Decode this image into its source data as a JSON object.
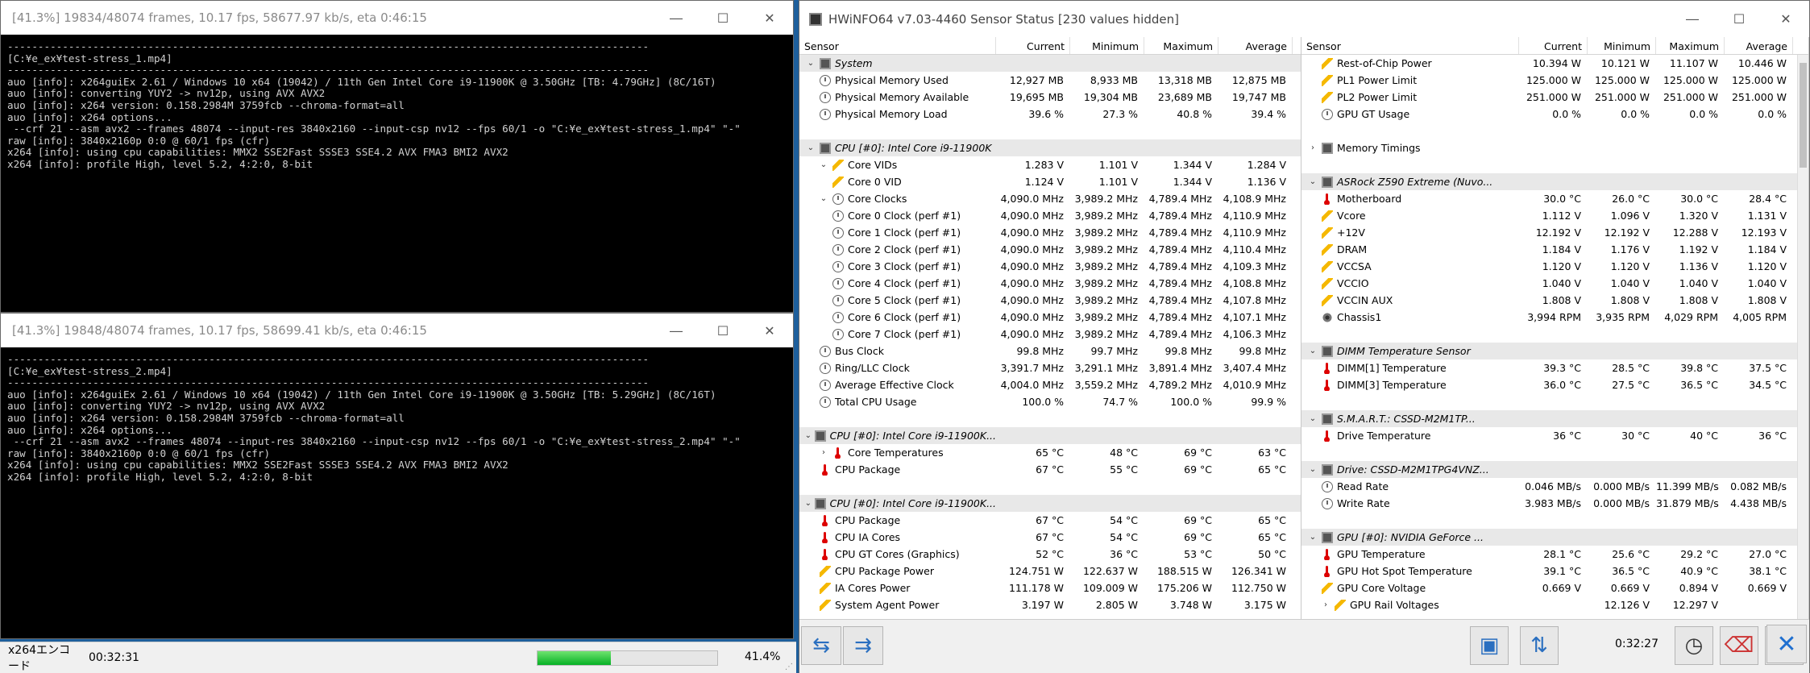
{
  "term1": {
    "title": "[41.3%] 19834/48074 frames, 10.17 fps, 58677.97 kb/s, eta 0:46:15",
    "lines": [
      "---------------------------------------------------------------------------------------------------------",
      "[C:¥e_ex¥test-stress_1.mp4]",
      "---------------------------------------------------------------------------------------------------------",
      "auo [info]: x264guiEx 2.61 / Windows 10 x64 (19042) / 11th Gen Intel Core i9-11900K @ 3.50GHz [TB: 4.79GHz] (8C/16T)",
      "auo [info]: converting YUY2 -> nv12p, using AVX AVX2",
      "auo [info]: x264 version: 0.158.2984M 3759fcb --chroma-format=all",
      "auo [info]: x264 options...",
      " --crf 21 --asm avx2 --frames 48074 --input-res 3840x2160 --input-csp nv12 --fps 60/1 -o \"C:¥e_ex¥test-stress_1.mp4\" \"-\"",
      "raw [info]: 3840x2160p 0:0 @ 60/1 fps (cfr)",
      "x264 [info]: using cpu capabilities: MMX2 SSE2Fast SSSE3 SSE4.2 AVX FMA3 BMI2 AVX2",
      "x264 [info]: profile High, level 5.2, 4:2:0, 8-bit"
    ]
  },
  "term2": {
    "title": "[41.3%] 19848/48074 frames, 10.17 fps, 58699.41 kb/s, eta 0:46:15",
    "lines": [
      "---------------------------------------------------------------------------------------------------------",
      "[C:¥e_ex¥test-stress_2.mp4]",
      "---------------------------------------------------------------------------------------------------------",
      "auo [info]: x264guiEx 2.61 / Windows 10 x64 (19042) / 11th Gen Intel Core i9-11900K @ 3.50GHz [TB: 5.29GHz] (8C/16T)",
      "auo [info]: converting YUY2 -> nv12p, using AVX AVX2",
      "auo [info]: x264 version: 0.158.2984M 3759fcb --chroma-format=all",
      "auo [info]: x264 options...",
      " --crf 21 --asm avx2 --frames 48074 --input-res 3840x2160 --input-csp nv12 --fps 60/1 -o \"C:¥e_ex¥test-stress_2.mp4\" \"-\"",
      "raw [info]: 3840x2160p 0:0 @ 60/1 fps (cfr)",
      "x264 [info]: using cpu capabilities: MMX2 SSE2Fast SSSE3 SSE4.2 AVX FMA3 BMI2 AVX2",
      "x264 [info]: profile High, level 5.2, 4:2:0, 8-bit"
    ]
  },
  "x264bar": {
    "label": "x264エンコード",
    "elapsed": "00:32:31",
    "percent": "41.4%",
    "progress": 0.41
  },
  "hwinfo": {
    "title": "HWiNFO64 v7.03-4460 Sensor Status [230 values hidden]",
    "headers": [
      "Sensor",
      "Current",
      "Minimum",
      "Maximum",
      "Average"
    ],
    "time": "0:32:27",
    "left_rows": [
      {
        "t": "group",
        "exp": "⌄",
        "icon": "chip",
        "name": "System"
      },
      {
        "t": "row",
        "icon": "clock",
        "name": "Physical Memory Used",
        "v": [
          "12,927 MB",
          "8,933 MB",
          "13,318 MB",
          "12,875 MB"
        ]
      },
      {
        "t": "row",
        "icon": "clock",
        "name": "Physical Memory Available",
        "v": [
          "19,695 MB",
          "19,304 MB",
          "23,689 MB",
          "19,747 MB"
        ]
      },
      {
        "t": "row",
        "icon": "clock",
        "name": "Physical Memory Load",
        "v": [
          "39.6 %",
          "27.3 %",
          "40.8 %",
          "39.4 %"
        ]
      },
      {
        "t": "blank"
      },
      {
        "t": "group",
        "exp": "⌄",
        "icon": "chip",
        "name": "CPU [#0]: Intel Core i9-11900K"
      },
      {
        "t": "row",
        "exp": "⌄",
        "icon": "volt",
        "name": "Core VIDs",
        "v": [
          "1.283 V",
          "1.101 V",
          "1.344 V",
          "1.284 V"
        ],
        "ind": 1
      },
      {
        "t": "row",
        "icon": "volt",
        "name": "Core 0 VID",
        "v": [
          "1.124 V",
          "1.101 V",
          "1.344 V",
          "1.136 V"
        ],
        "ind": 1
      },
      {
        "t": "row",
        "exp": "⌄",
        "icon": "clock",
        "name": "Core Clocks",
        "v": [
          "4,090.0 MHz",
          "3,989.2 MHz",
          "4,789.4 MHz",
          "4,108.9 MHz"
        ],
        "ind": 1
      },
      {
        "t": "row",
        "icon": "clock",
        "name": "Core 0 Clock (perf #1)",
        "v": [
          "4,090.0 MHz",
          "3,989.2 MHz",
          "4,789.4 MHz",
          "4,110.9 MHz"
        ],
        "ind": 1
      },
      {
        "t": "row",
        "icon": "clock",
        "name": "Core 1 Clock (perf #1)",
        "v": [
          "4,090.0 MHz",
          "3,989.2 MHz",
          "4,789.4 MHz",
          "4,110.9 MHz"
        ],
        "ind": 1
      },
      {
        "t": "row",
        "icon": "clock",
        "name": "Core 2 Clock (perf #1)",
        "v": [
          "4,090.0 MHz",
          "3,989.2 MHz",
          "4,789.4 MHz",
          "4,110.4 MHz"
        ],
        "ind": 1
      },
      {
        "t": "row",
        "icon": "clock",
        "name": "Core 3 Clock (perf #1)",
        "v": [
          "4,090.0 MHz",
          "3,989.2 MHz",
          "4,789.4 MHz",
          "4,109.3 MHz"
        ],
        "ind": 1
      },
      {
        "t": "row",
        "icon": "clock",
        "name": "Core 4 Clock (perf #1)",
        "v": [
          "4,090.0 MHz",
          "3,989.2 MHz",
          "4,789.4 MHz",
          "4,108.8 MHz"
        ],
        "ind": 1
      },
      {
        "t": "row",
        "icon": "clock",
        "name": "Core 5 Clock (perf #1)",
        "v": [
          "4,090.0 MHz",
          "3,989.2 MHz",
          "4,789.4 MHz",
          "4,107.8 MHz"
        ],
        "ind": 1
      },
      {
        "t": "row",
        "icon": "clock",
        "name": "Core 6 Clock (perf #1)",
        "v": [
          "4,090.0 MHz",
          "3,989.2 MHz",
          "4,789.4 MHz",
          "4,107.1 MHz"
        ],
        "ind": 1
      },
      {
        "t": "row",
        "icon": "clock",
        "name": "Core 7 Clock (perf #1)",
        "v": [
          "4,090.0 MHz",
          "3,989.2 MHz",
          "4,789.4 MHz",
          "4,106.3 MHz"
        ],
        "ind": 1
      },
      {
        "t": "row",
        "icon": "clock",
        "name": "Bus Clock",
        "v": [
          "99.8 MHz",
          "99.7 MHz",
          "99.8 MHz",
          "99.8 MHz"
        ]
      },
      {
        "t": "row",
        "icon": "clock",
        "name": "Ring/LLC Clock",
        "v": [
          "3,391.7 MHz",
          "3,291.1 MHz",
          "3,891.4 MHz",
          "3,407.4 MHz"
        ]
      },
      {
        "t": "row",
        "icon": "clock",
        "name": "Average Effective Clock",
        "v": [
          "4,004.0 MHz",
          "3,559.2 MHz",
          "4,789.2 MHz",
          "4,010.9 MHz"
        ]
      },
      {
        "t": "row",
        "icon": "clock",
        "name": "Total CPU Usage",
        "v": [
          "100.0 %",
          "74.7 %",
          "100.0 %",
          "99.9 %"
        ]
      },
      {
        "t": "blank"
      },
      {
        "t": "group",
        "exp": "⌄",
        "icon": "chip",
        "name": "CPU [#0]: Intel Core i9-11900K..."
      },
      {
        "t": "row",
        "exp": "›",
        "icon": "therm",
        "name": "Core Temperatures",
        "v": [
          "65 °C",
          "48 °C",
          "69 °C",
          "63 °C"
        ],
        "ind": 1
      },
      {
        "t": "row",
        "icon": "therm",
        "name": "CPU Package",
        "v": [
          "67 °C",
          "55 °C",
          "69 °C",
          "65 °C"
        ]
      },
      {
        "t": "blank"
      },
      {
        "t": "group",
        "exp": "⌄",
        "icon": "chip",
        "name": "CPU [#0]: Intel Core i9-11900K..."
      },
      {
        "t": "row",
        "icon": "therm",
        "name": "CPU Package",
        "v": [
          "67 °C",
          "54 °C",
          "69 °C",
          "65 °C"
        ]
      },
      {
        "t": "row",
        "icon": "therm",
        "name": "CPU IA Cores",
        "v": [
          "67 °C",
          "54 °C",
          "69 °C",
          "65 °C"
        ]
      },
      {
        "t": "row",
        "icon": "therm",
        "name": "CPU GT Cores (Graphics)",
        "v": [
          "52 °C",
          "36 °C",
          "53 °C",
          "50 °C"
        ]
      },
      {
        "t": "row",
        "icon": "volt",
        "name": "CPU Package Power",
        "v": [
          "124.751 W",
          "122.637 W",
          "188.515 W",
          "126.341 W"
        ]
      },
      {
        "t": "row",
        "icon": "volt",
        "name": "IA Cores Power",
        "v": [
          "111.178 W",
          "109.009 W",
          "175.206 W",
          "112.750 W"
        ]
      },
      {
        "t": "row",
        "icon": "volt",
        "name": "System Agent Power",
        "v": [
          "3.197 W",
          "2.805 W",
          "3.748 W",
          "3.175 W"
        ]
      }
    ],
    "right_rows": [
      {
        "t": "row",
        "icon": "volt",
        "name": "Rest-of-Chip Power",
        "v": [
          "10.394 W",
          "10.121 W",
          "11.107 W",
          "10.446 W"
        ]
      },
      {
        "t": "row",
        "icon": "volt",
        "name": "PL1 Power Limit",
        "v": [
          "125.000 W",
          "125.000 W",
          "125.000 W",
          "125.000 W"
        ]
      },
      {
        "t": "row",
        "icon": "volt",
        "name": "PL2 Power Limit",
        "v": [
          "251.000 W",
          "251.000 W",
          "251.000 W",
          "251.000 W"
        ]
      },
      {
        "t": "row",
        "icon": "clock",
        "name": "GPU GT Usage",
        "v": [
          "0.0 %",
          "0.0 %",
          "0.0 %",
          "0.0 %"
        ]
      },
      {
        "t": "blank"
      },
      {
        "t": "group",
        "exp": "›",
        "icon": "chip",
        "name": "Memory Timings",
        "plain": true
      },
      {
        "t": "blank"
      },
      {
        "t": "group",
        "exp": "⌄",
        "icon": "chip",
        "name": "ASRock Z590 Extreme (Nuvo..."
      },
      {
        "t": "row",
        "icon": "therm",
        "name": "Motherboard",
        "v": [
          "30.0 °C",
          "26.0 °C",
          "30.0 °C",
          "28.4 °C"
        ]
      },
      {
        "t": "row",
        "icon": "volt",
        "name": "Vcore",
        "v": [
          "1.112 V",
          "1.096 V",
          "1.320 V",
          "1.131 V"
        ]
      },
      {
        "t": "row",
        "icon": "volt",
        "name": "+12V",
        "v": [
          "12.192 V",
          "12.192 V",
          "12.288 V",
          "12.193 V"
        ]
      },
      {
        "t": "row",
        "icon": "volt",
        "name": "DRAM",
        "v": [
          "1.184 V",
          "1.176 V",
          "1.192 V",
          "1.184 V"
        ]
      },
      {
        "t": "row",
        "icon": "volt",
        "name": "VCCSA",
        "v": [
          "1.120 V",
          "1.120 V",
          "1.136 V",
          "1.120 V"
        ]
      },
      {
        "t": "row",
        "icon": "volt",
        "name": "VCCIO",
        "v": [
          "1.040 V",
          "1.040 V",
          "1.040 V",
          "1.040 V"
        ]
      },
      {
        "t": "row",
        "icon": "volt",
        "name": "VCCIN AUX",
        "v": [
          "1.808 V",
          "1.808 V",
          "1.808 V",
          "1.808 V"
        ]
      },
      {
        "t": "row",
        "icon": "fan",
        "name": "Chassis1",
        "v": [
          "3,994 RPM",
          "3,935 RPM",
          "4,029 RPM",
          "4,005 RPM"
        ]
      },
      {
        "t": "blank"
      },
      {
        "t": "group",
        "exp": "⌄",
        "icon": "chip",
        "name": "DIMM Temperature Sensor"
      },
      {
        "t": "row",
        "icon": "therm",
        "name": "DIMM[1] Temperature",
        "v": [
          "39.3 °C",
          "28.5 °C",
          "39.8 °C",
          "37.5 °C"
        ]
      },
      {
        "t": "row",
        "icon": "therm",
        "name": "DIMM[3] Temperature",
        "v": [
          "36.0 °C",
          "27.5 °C",
          "36.5 °C",
          "34.5 °C"
        ]
      },
      {
        "t": "blank"
      },
      {
        "t": "group",
        "exp": "⌄",
        "icon": "chip",
        "name": "S.M.A.R.T.: CSSD-M2M1TP..."
      },
      {
        "t": "row",
        "icon": "therm",
        "name": "Drive Temperature",
        "v": [
          "36 °C",
          "30 °C",
          "40 °C",
          "36 °C"
        ]
      },
      {
        "t": "blank"
      },
      {
        "t": "group",
        "exp": "⌄",
        "icon": "chip",
        "name": "Drive: CSSD-M2M1TPG4VNZ..."
      },
      {
        "t": "row",
        "icon": "clock",
        "name": "Read Rate",
        "v": [
          "0.046 MB/s",
          "0.000 MB/s",
          "11.399 MB/s",
          "0.082 MB/s"
        ]
      },
      {
        "t": "row",
        "icon": "clock",
        "name": "Write Rate",
        "v": [
          "3.983 MB/s",
          "0.000 MB/s",
          "31.879 MB/s",
          "4.438 MB/s"
        ]
      },
      {
        "t": "blank"
      },
      {
        "t": "group",
        "exp": "⌄",
        "icon": "chip",
        "name": "GPU [#0]: NVIDIA GeForce ..."
      },
      {
        "t": "row",
        "icon": "therm",
        "name": "GPU Temperature",
        "v": [
          "28.1 °C",
          "25.6 °C",
          "29.2 °C",
          "27.0 °C"
        ]
      },
      {
        "t": "row",
        "icon": "therm",
        "name": "GPU Hot Spot Temperature",
        "v": [
          "39.1 °C",
          "36.5 °C",
          "40.9 °C",
          "38.1 °C"
        ]
      },
      {
        "t": "row",
        "icon": "volt",
        "name": "GPU Core Voltage",
        "v": [
          "0.669 V",
          "0.669 V",
          "0.894 V",
          "0.669 V"
        ]
      },
      {
        "t": "row",
        "exp": "›",
        "icon": "volt",
        "name": "GPU Rail Voltages",
        "v": [
          "",
          "12.126 V",
          "12.297 V",
          ""
        ],
        "ind": 1
      }
    ]
  }
}
